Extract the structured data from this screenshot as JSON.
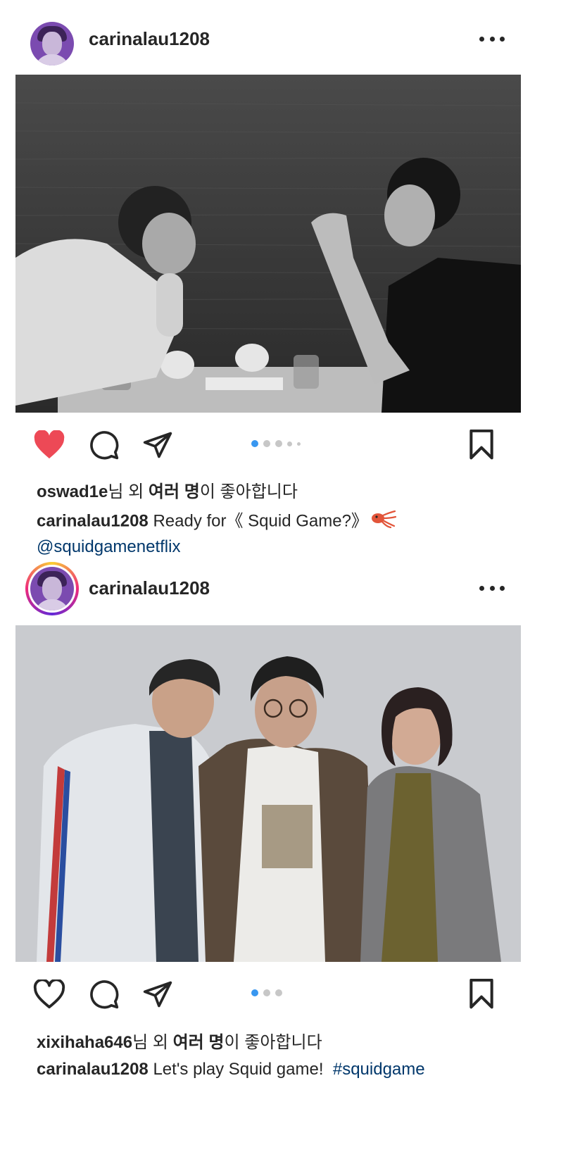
{
  "posts": [
    {
      "username": "carinalau1208",
      "liked": true,
      "carousel_pages": 5,
      "carousel_active": 1,
      "likes": {
        "user": "oswad1e",
        "suffix_pre": "님 외 ",
        "bold": "여러 명",
        "suffix_post": "이 좋아합니다"
      },
      "caption": {
        "user": "carinalau1208",
        "text": " Ready for《 Squid Game?》",
        "emoji_icon": "squid-icon",
        "mention": "@squidgamenetflix"
      }
    },
    {
      "username": "carinalau1208",
      "liked": false,
      "carousel_pages": 3,
      "carousel_active": 1,
      "likes": {
        "user": "xixihaha646",
        "suffix_pre": "님 외 ",
        "bold": "여러 명",
        "suffix_post": "이 좋아합니다"
      },
      "caption": {
        "user": "carinalau1208",
        "text": " Let's play Squid game!  ",
        "hashtag": "#squidgame"
      }
    }
  ],
  "icons": [
    "heart-icon",
    "comment-icon",
    "share-icon",
    "bookmark-icon",
    "more-icon"
  ],
  "colors": {
    "like_red": "#ed4956",
    "link_blue": "#00376b",
    "dot_active": "#3897f0"
  }
}
